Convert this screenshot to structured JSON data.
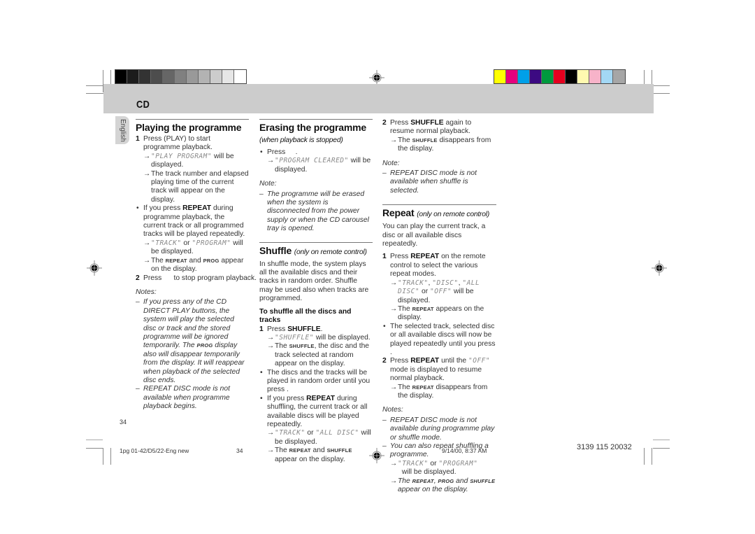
{
  "color_bar_left": [
    "#000000",
    "#1c1c1c",
    "#333333",
    "#4d4d4d",
    "#666666",
    "#808080",
    "#999999",
    "#b3b3b3",
    "#cccccc",
    "#e6e6e6",
    "#ffffff"
  ],
  "color_bar_right": [
    "#ffff00",
    "#e6007e",
    "#00a0e9",
    "#3c0a82",
    "#009a3e",
    "#e5001f",
    "#000000",
    "#fff9b0",
    "#f7b3c9",
    "#a3d8f5",
    "#a6a6a6"
  ],
  "header": {
    "section_title": "CD"
  },
  "language_tab": "English",
  "col1": {
    "heading": "Playing the programme",
    "step1_num": "1",
    "step1_text": "Press   (PLAY) to start programme playback.",
    "step1_arrow1_lcd": "\"PLAY PROGRAM\"",
    "step1_arrow1_text": " will be displayed.",
    "step1_arrow2": "The track number and elapsed playing time of the current track will appear on the display.",
    "bullet1_pre": "If you press ",
    "bullet1_bold": "REPEAT",
    "bullet1_post": " during programme playback, the current track or all programmed tracks will be played repeatedly.",
    "bullet1_arrow1_lcd1": "\"TRACK\"",
    "bullet1_arrow1_mid": " or ",
    "bullet1_arrow1_lcd2": "\"PROGRAM\"",
    "bullet1_arrow1_post": " will be displayed.",
    "bullet1_arrow2_pre": "The ",
    "bullet1_arrow2_sc1": "REPEAT",
    "bullet1_arrow2_mid": " and ",
    "bullet1_arrow2_sc2": "PROG",
    "bullet1_arrow2_post": " appear on the display.",
    "step2_num": "2",
    "step2_text": "Press      to stop program playback.",
    "notes_heading": "Notes:",
    "note1_pre": "If you press any of the CD DIRECT PLAY buttons, the system will play the selected disc or track and the stored programme will be ignored temporarily. The ",
    "note1_sc": "PROG",
    "note1_post": " display also will disappear temporarily from the display. It will reappear when playback of the selected disc ends.",
    "note2": "REPEAT DISC mode is not available when programme playback begins."
  },
  "col2": {
    "erase_heading": "Erasing the programme",
    "erase_sub": "(when playback is stopped)",
    "erase_bullet": "Press     .",
    "erase_arrow_lcd": "\"PROGRAM CLEARED\"",
    "erase_arrow_text": " will be displayed.",
    "erase_note_heading": "Note:",
    "erase_note": "The programme will be erased when the system is disconnected from the power supply or when the CD carousel tray is opened.",
    "shuffle_heading": "Shuffle",
    "shuffle_sub": "(only on remote control)",
    "shuffle_intro": "In shuffle mode, the system plays all the available discs and their tracks in random order. Shuffle may be used also when tracks are programmed.",
    "shuffle_subheading": "To shuffle all the discs and tracks",
    "step1_num": "1",
    "step1_pre": "Press ",
    "step1_bold": "SHUFFLE",
    "step1_post": ".",
    "step1_arrow1_lcd": "\"SHUFFLE\"",
    "step1_arrow1_text": " will be displayed.",
    "step1_arrow2_pre": "The ",
    "step1_arrow2_sc": "SHUFFLE",
    "step1_arrow2_post": ", the disc and the track selected at random appear on the display.",
    "bullet1": "The discs and the tracks will be played in random order until you press     .",
    "bullet2_pre": "If you press ",
    "bullet2_bold": "REPEAT",
    "bullet2_post": " during shuffling, the current track or all available discs will be played repeatedly.",
    "bullet2_arrow1_lcd1": "\"TRACK\"",
    "bullet2_arrow1_mid": " or ",
    "bullet2_arrow1_lcd2": "\"ALL DISC\"",
    "bullet2_arrow1_post": " will be displayed.",
    "bullet2_arrow2_pre": "The ",
    "bullet2_arrow2_sc1": "REPEAT",
    "bullet2_arrow2_mid": " and ",
    "bullet2_arrow2_sc2": "SHUFFLE",
    "bullet2_arrow2_post": " appear on the display."
  },
  "col3": {
    "step2_num": "2",
    "step2_pre": "Press ",
    "step2_bold": "SHUFFLE",
    "step2_post": " again to resume normal playback.",
    "step2_arrow_pre": "The ",
    "step2_arrow_sc": "SHUFFLE",
    "step2_arrow_post": " disappears from the display.",
    "note_heading": "Note:",
    "note": "REPEAT DISC mode is not available when shuffle is selected.",
    "repeat_heading": "Repeat",
    "repeat_sub": "(only on remote control)",
    "repeat_intro": "You can play the current track, a disc or all available discs repeatedly.",
    "step1_num": "1",
    "step1_pre": "Press ",
    "step1_bold": "REPEAT",
    "step1_post": " on the remote control to select the various repeat modes.",
    "step1_arrow1_lcd1": "\"TRACK\"",
    "step1_arrow1_sep1": ", ",
    "step1_arrow1_lcd2": "\"DISC\"",
    "step1_arrow1_sep2": ", ",
    "step1_arrow1_lcd3": "\"ALL DISC\"",
    "step1_arrow1_sep3": " or ",
    "step1_arrow1_lcd4": "\"OFF\"",
    "step1_arrow1_post": " will be displayed.",
    "step1_arrow2_pre": "The ",
    "step1_arrow2_sc": "REPEAT",
    "step1_arrow2_post": " appears on the display.",
    "bullet1": "The selected track, selected disc or all available discs will now be played repeatedly until you press     .",
    "step2b_num": "2",
    "step2b_pre": "Press ",
    "step2b_bold": "REPEAT",
    "step2b_mid": " until the ",
    "step2b_lcd": "\"OFF\"",
    "step2b_post": " mode is displayed to resume normal playback.",
    "step2b_arrow_pre": "The ",
    "step2b_arrow_sc": "REPEAT",
    "step2b_arrow_post": " disappears from the display.",
    "notes_heading": "Notes:",
    "note1": "REPEAT DISC mode is not available during programme play or shuffle mode.",
    "note2": "You can also repeat shuffling a programme.",
    "note2_arrow1_lcd1": "\"TRACK\"",
    "note2_arrow1_mid": " or ",
    "note2_arrow1_lcd2": "\"PROGRAM\"",
    "note2_arrow1_post": "  will be displayed.",
    "note2_arrow2_pre": "The ",
    "note2_arrow2_sc1": "REPEAT",
    "note2_arrow2_sep": ", ",
    "note2_arrow2_sc2": "PROG",
    "note2_arrow2_mid": " and ",
    "note2_arrow2_sc3": "SHUFFLE",
    "note2_arrow2_post": " appear on the display."
  },
  "page_number": "34",
  "footer": {
    "file_name": "1pg 01-42/D5/22-Eng new",
    "file_page": "34",
    "timestamp": "9/14/00, 8:37 AM",
    "doc_code": "3139 115 20032"
  },
  "glyphs": {
    "arrow": "→",
    "bullet": "•",
    "dash": "–"
  }
}
